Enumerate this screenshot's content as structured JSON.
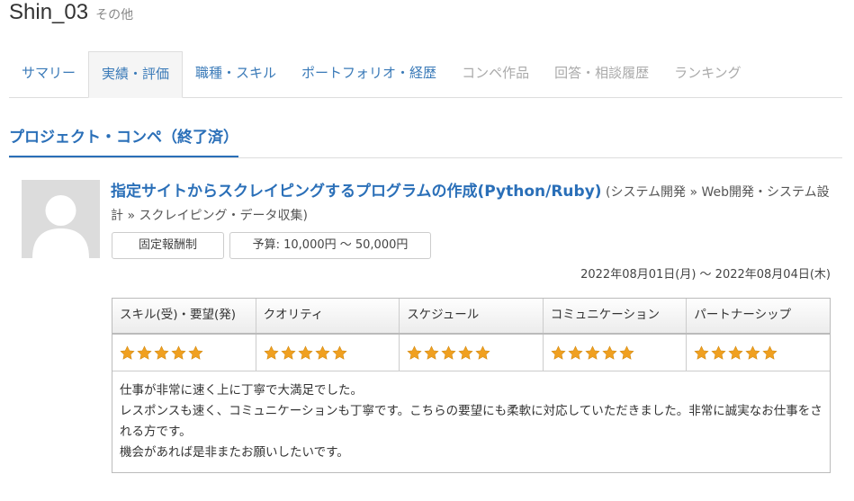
{
  "profile": {
    "username": "Shin_03",
    "role": "その他"
  },
  "tabs": [
    {
      "label": "サマリー",
      "state": "normal"
    },
    {
      "label": "実績・評価",
      "state": "active"
    },
    {
      "label": "職種・スキル",
      "state": "normal"
    },
    {
      "label": "ポートフォリオ・経歴",
      "state": "normal"
    },
    {
      "label": "コンペ作品",
      "state": "disabled"
    },
    {
      "label": "回答・相談履歴",
      "state": "disabled"
    },
    {
      "label": "ランキング",
      "state": "disabled"
    }
  ],
  "section": {
    "title": "プロジェクト・コンペ（終了済）"
  },
  "project": {
    "title": "指定サイトからスクレイピングするプログラムの作成(Python/Ruby)",
    "category": "(システム開発 » Web開発・システム設計 » スクレイピング・データ収集)",
    "payment_type": "固定報酬制",
    "budget": "予算: 10,000円 〜 50,000円",
    "period": "2022年08月01日(月) 〜 2022年08月04日(木)"
  },
  "rating": {
    "star_color": "#f0a020",
    "headers": [
      "スキル(受)・要望(発)",
      "クオリティ",
      "スケジュール",
      "コミュニケーション",
      "パートナーシップ"
    ],
    "scores": [
      5,
      5,
      5,
      5,
      5
    ],
    "comment_lines": [
      "仕事が非常に速く上に丁寧で大満足でした。",
      "レスポンスも速く、コミュニケーションも丁寧です。こちらの要望にも柔軟に対応していただきました。非常に誠実なお仕事をされる方です。",
      "機会があれば是非またお願いしたいです。"
    ]
  }
}
